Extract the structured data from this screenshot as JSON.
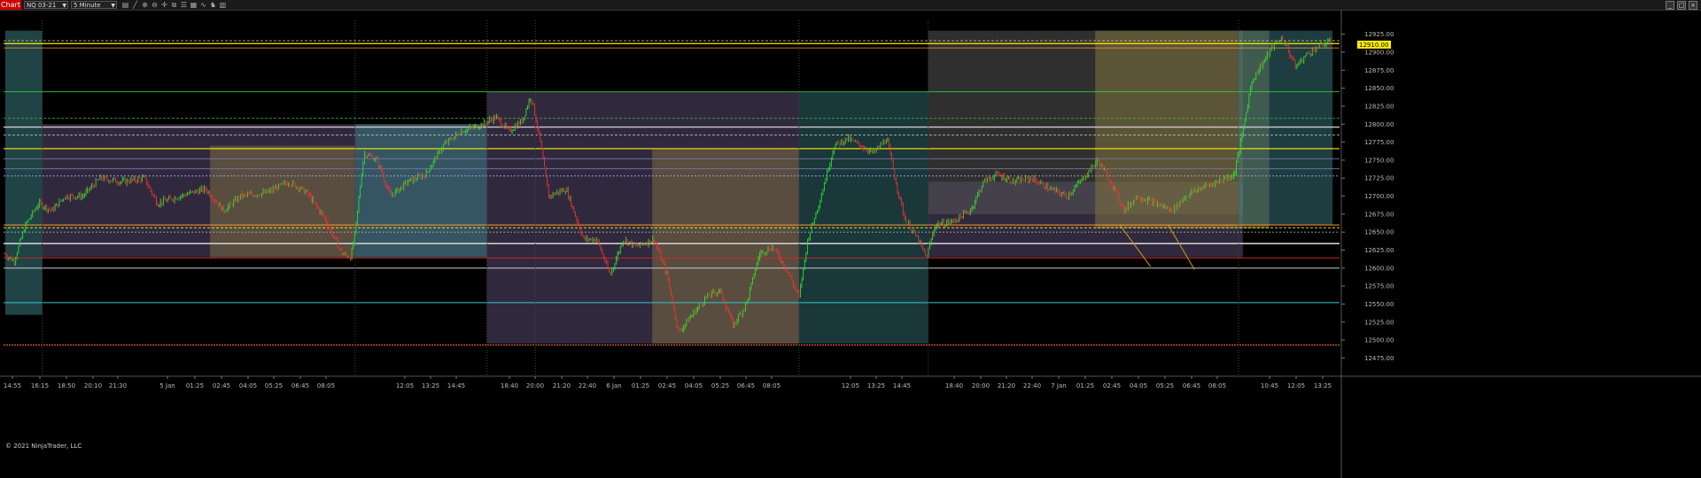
{
  "toolbar": {
    "chart_tab": "Chart",
    "instrument": "NQ 03-21",
    "interval": "5 Minute",
    "icons": [
      "bar-type-icon",
      "drawing-tool-icon",
      "zoom-in-icon",
      "zoom-out-icon",
      "crosshair-icon",
      "copy-icon",
      "properties-icon",
      "templates-icon",
      "indicator-icon",
      "strategy-icon",
      "data-box-icon"
    ]
  },
  "window_buttons": [
    "minimize-icon",
    "maximize-icon",
    "close-icon"
  ],
  "copyright": "© 2021 NinjaTrader, LLC",
  "price_tag": "12910.00",
  "colors": {
    "up": "#33dd33",
    "down": "#ee3333",
    "price_tag": "#ffee00"
  },
  "chart_data": {
    "type": "candlestick",
    "instrument": "NQ 03-21",
    "interval": "5 Minute",
    "ylim": [
      12462,
      12932
    ],
    "yticks": [
      "12925.00",
      "12900.00",
      "12875.00",
      "12850.00",
      "12825.00",
      "12800.00",
      "12775.00",
      "12750.00",
      "12725.00",
      "12700.00",
      "12675.00",
      "12650.00",
      "12625.00",
      "12600.00",
      "12575.00",
      "12550.00",
      "12525.00",
      "12500.00",
      "12475.00"
    ],
    "xticks": [
      "14:55",
      "16:15",
      "18:50",
      "20:10",
      "21:30",
      "5 Jan",
      "01:25",
      "02:45",
      "04:05",
      "05:25",
      "06:45",
      "08:05",
      "12:05",
      "13:25",
      "14:45",
      "18:40",
      "20:00",
      "21:20",
      "22:40",
      "6 Jan",
      "01:25",
      "02:45",
      "04:05",
      "05:25",
      "06:45",
      "08:05",
      "12:05",
      "13:25",
      "14:45",
      "18:40",
      "20:00",
      "21:20",
      "22:40",
      "7 Jan",
      "01:25",
      "02:45",
      "04:05",
      "05:25",
      "06:45",
      "08:05",
      "10:45",
      "12:05",
      "13:25"
    ],
    "last_price": 12910,
    "price_path": [
      [
        0,
        12620
      ],
      [
        12,
        12610
      ],
      [
        25,
        12660
      ],
      [
        40,
        12690
      ],
      [
        55,
        12680
      ],
      [
        70,
        12700
      ],
      [
        90,
        12700
      ],
      [
        110,
        12725
      ],
      [
        135,
        12720
      ],
      [
        160,
        12725
      ],
      [
        175,
        12690
      ],
      [
        200,
        12700
      ],
      [
        230,
        12710
      ],
      [
        250,
        12680
      ],
      [
        270,
        12700
      ],
      [
        300,
        12705
      ],
      [
        325,
        12720
      ],
      [
        345,
        12705
      ],
      [
        365,
        12670
      ],
      [
        385,
        12620
      ],
      [
        395,
        12615
      ],
      [
        400,
        12650
      ],
      [
        410,
        12760
      ],
      [
        425,
        12750
      ],
      [
        440,
        12700
      ],
      [
        460,
        12720
      ],
      [
        480,
        12730
      ],
      [
        500,
        12770
      ],
      [
        520,
        12790
      ],
      [
        545,
        12800
      ],
      [
        560,
        12810
      ],
      [
        575,
        12790
      ],
      [
        590,
        12805
      ],
      [
        600,
        12840
      ],
      [
        610,
        12780
      ],
      [
        620,
        12700
      ],
      [
        640,
        12710
      ],
      [
        660,
        12640
      ],
      [
        675,
        12640
      ],
      [
        690,
        12590
      ],
      [
        705,
        12640
      ],
      [
        720,
        12630
      ],
      [
        740,
        12640
      ],
      [
        755,
        12590
      ],
      [
        768,
        12510
      ],
      [
        780,
        12530
      ],
      [
        800,
        12560
      ],
      [
        815,
        12570
      ],
      [
        830,
        12520
      ],
      [
        845,
        12550
      ],
      [
        860,
        12620
      ],
      [
        875,
        12630
      ],
      [
        890,
        12600
      ],
      [
        905,
        12560
      ],
      [
        915,
        12640
      ],
      [
        930,
        12700
      ],
      [
        945,
        12770
      ],
      [
        960,
        12780
      ],
      [
        975,
        12770
      ],
      [
        990,
        12760
      ],
      [
        1005,
        12780
      ],
      [
        1015,
        12720
      ],
      [
        1025,
        12670
      ],
      [
        1040,
        12640
      ],
      [
        1050,
        12615
      ],
      [
        1060,
        12660
      ],
      [
        1080,
        12665
      ],
      [
        1100,
        12680
      ],
      [
        1115,
        12720
      ],
      [
        1130,
        12730
      ],
      [
        1150,
        12720
      ],
      [
        1170,
        12725
      ],
      [
        1190,
        12710
      ],
      [
        1210,
        12700
      ],
      [
        1225,
        12720
      ],
      [
        1245,
        12750
      ],
      [
        1260,
        12720
      ],
      [
        1275,
        12680
      ],
      [
        1290,
        12700
      ],
      [
        1310,
        12690
      ],
      [
        1330,
        12680
      ],
      [
        1345,
        12700
      ],
      [
        1360,
        12710
      ],
      [
        1380,
        12720
      ],
      [
        1400,
        12730
      ],
      [
        1410,
        12790
      ],
      [
        1420,
        12860
      ],
      [
        1430,
        12880
      ],
      [
        1445,
        12910
      ],
      [
        1455,
        12920
      ],
      [
        1470,
        12880
      ],
      [
        1485,
        12900
      ],
      [
        1500,
        12910
      ],
      [
        1510,
        12915
      ]
    ]
  }
}
